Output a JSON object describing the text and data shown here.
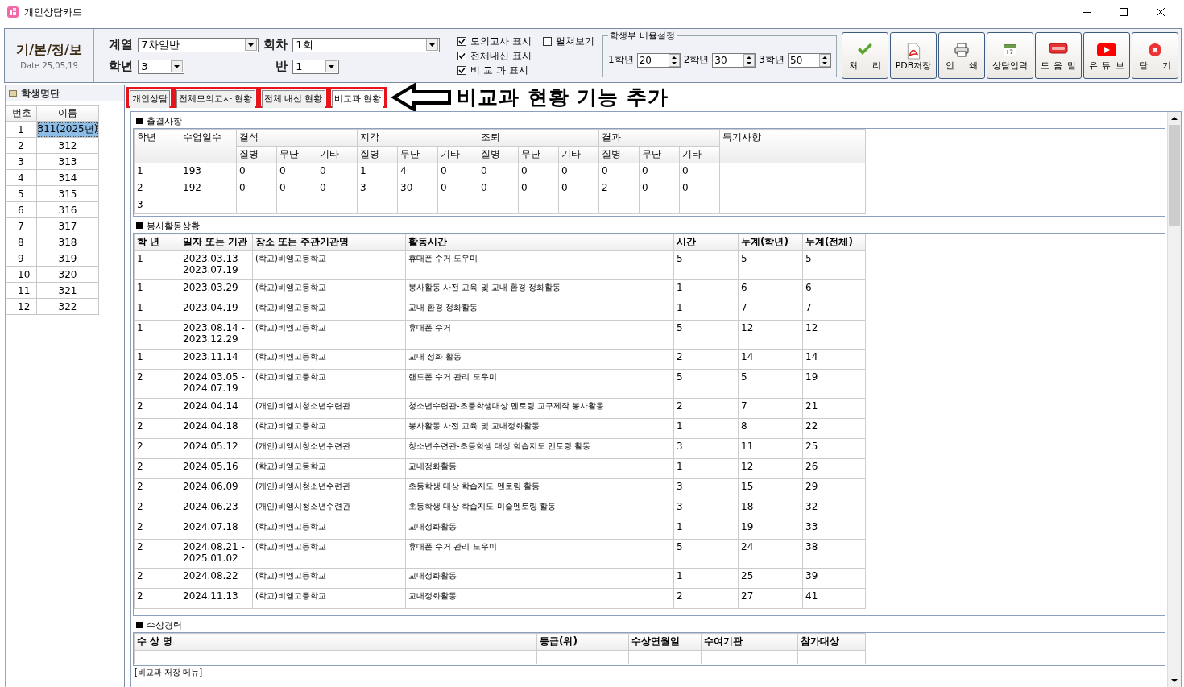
{
  "window": {
    "title": "개인상담카드"
  },
  "header": {
    "title": "기/본/정/보",
    "date": "Date 25,05,19"
  },
  "filters": [
    {
      "label": "계열",
      "value": "7차일반"
    },
    {
      "label": "회차",
      "value": "1회"
    },
    {
      "label": "학년",
      "value": "3"
    },
    {
      "label": "반",
      "value": "1"
    }
  ],
  "display_options": [
    {
      "label": "모의고사 표시",
      "checked": true
    },
    {
      "label": "전체내신 표시",
      "checked": true
    },
    {
      "label": "비 교 과 표시",
      "checked": true
    },
    {
      "label": "펼쳐보기",
      "checked": false
    }
  ],
  "ratio_settings": {
    "title": "학생부 비율설정",
    "fields": [
      {
        "label": "1학년",
        "value": "20"
      },
      {
        "label": "2학년",
        "value": "30"
      },
      {
        "label": "3학년",
        "value": "50"
      }
    ]
  },
  "toolbar": [
    {
      "kind": "check",
      "label": "처 리"
    },
    {
      "kind": "pdf",
      "label": "PDB저장"
    },
    {
      "kind": "print",
      "label": "인 쇄"
    },
    {
      "kind": "calendar",
      "label": "상담입력"
    },
    {
      "kind": "help",
      "label": "도 움 말"
    },
    {
      "kind": "video",
      "label": "유 튜 브"
    },
    {
      "kind": "close",
      "label": "닫 기"
    }
  ],
  "student_list": {
    "title": "학생명단",
    "columns": [
      "번호",
      "이름"
    ],
    "rows": [
      {
        "no": "1",
        "name": "311(2025년)",
        "selected": true
      },
      {
        "no": "2",
        "name": "312",
        "selected": false
      },
      {
        "no": "3",
        "name": "313",
        "selected": false
      },
      {
        "no": "4",
        "name": "314",
        "selected": false
      },
      {
        "no": "5",
        "name": "315",
        "selected": false
      },
      {
        "no": "6",
        "name": "316",
        "selected": false
      },
      {
        "no": "7",
        "name": "317",
        "selected": false
      },
      {
        "no": "8",
        "name": "318",
        "selected": false
      },
      {
        "no": "9",
        "name": "319",
        "selected": false
      },
      {
        "no": "10",
        "name": "320",
        "selected": false
      },
      {
        "no": "11",
        "name": "321",
        "selected": false
      },
      {
        "no": "12",
        "name": "322",
        "selected": false
      }
    ]
  },
  "tabs": [
    {
      "label": "개인상담",
      "selected": false
    },
    {
      "label": "전체모의고사 현황",
      "selected": false
    },
    {
      "label": "전체 내신 현황",
      "selected": false
    },
    {
      "label": "비교과 현황",
      "selected": true
    }
  ],
  "annotation": "비교과 현황 기능 추가",
  "attendance": {
    "title": "출결사항",
    "header_rows": [
      [
        {
          "text": "학년",
          "rowspan": 2
        },
        {
          "text": "수업일수",
          "rowspan": 2
        },
        {
          "text": "결석",
          "colspan": 3
        },
        {
          "text": "지각",
          "colspan": 3
        },
        {
          "text": "조퇴",
          "colspan": 3
        },
        {
          "text": "결과",
          "colspan": 3
        },
        {
          "text": "특기사항",
          "rowspan": 2
        }
      ],
      [
        {
          "text": "질병"
        },
        {
          "text": "무단"
        },
        {
          "text": "기타"
        },
        {
          "text": "질병"
        },
        {
          "text": "무단"
        },
        {
          "text": "기타"
        },
        {
          "text": "질병"
        },
        {
          "text": "무단"
        },
        {
          "text": "기타"
        },
        {
          "text": "질병"
        },
        {
          "text": "무단"
        },
        {
          "text": "기타"
        }
      ]
    ],
    "rows": [
      [
        "1",
        "193",
        "0",
        "0",
        "0",
        "1",
        "4",
        "0",
        "0",
        "0",
        "0",
        "0",
        "0",
        "0"
      ],
      [
        "2",
        "192",
        "0",
        "0",
        "0",
        "3",
        "30",
        "0",
        "0",
        "0",
        "0",
        "2",
        "0",
        "0"
      ],
      [
        "3"
      ]
    ]
  },
  "service": {
    "title": "봉사활동상황",
    "columns": [
      "학 년",
      "일자 또는 기관",
      "장소 또는 주관기관명",
      "활동시간",
      "시간",
      "누계(학년)",
      "누계(전체)"
    ],
    "rows": [
      [
        "1",
        "2023.03.13 -\n2023.07.19",
        "(학교)비엠고등학교",
        "휴대폰 수거 도우미",
        "5",
        "5",
        "5"
      ],
      [
        "1",
        "2023.03.29",
        "(학교)비엠고등학교",
        "봉사활동 사전 교육 및 교내 환경 정화활동",
        "1",
        "6",
        "6"
      ],
      [
        "1",
        "2023.04.19",
        "(학교)비엠고등학교",
        "교내 환경 정화활동",
        "1",
        "7",
        "7"
      ],
      [
        "1",
        "2023.08.14 -\n2023.12.29",
        "(학교)비엠고등학교",
        "휴대폰 수거",
        "5",
        "12",
        "12"
      ],
      [
        "1",
        "2023.11.14",
        "(학교)비엠고등학교",
        "교내 정화 활동",
        "2",
        "14",
        "14"
      ],
      [
        "2",
        "2024.03.05 -\n2024.07.19",
        "(학교)비엠고등학교",
        "핸드폰 수거 관리 도우미",
        "5",
        "5",
        "19"
      ],
      [
        "2",
        "2024.04.14",
        "(개인)비엠시청소년수련관",
        "청소년수련관-초등학생대상 멘토링 교구제작 봉사활동",
        "2",
        "7",
        "21"
      ],
      [
        "2",
        "2024.04.18",
        "(학교)비엠고등학교",
        "봉사활동 사전 교육 및 교내정화활동",
        "1",
        "8",
        "22"
      ],
      [
        "2",
        "2024.05.12",
        "(개인)비엠시청소년수련관",
        "청소년수련관-초등학생 대상 학습지도 멘토링 활동",
        "3",
        "11",
        "25"
      ],
      [
        "2",
        "2024.05.16",
        "(학교)비엠고등학교",
        "교내정화활동",
        "1",
        "12",
        "26"
      ],
      [
        "2",
        "2024.06.09",
        "(개인)비엠시청소년수련관",
        "초등학생 대상 학습지도 멘토링 활동",
        "3",
        "15",
        "29"
      ],
      [
        "2",
        "2024.06.23",
        "(개인)비엠시청소년수련관",
        "초등학생 대상 학습지도 미술멘토링 활동",
        "3",
        "18",
        "32"
      ],
      [
        "2",
        "2024.07.18",
        "(학교)비엠고등학교",
        "교내정화활동",
        "1",
        "19",
        "33"
      ],
      [
        "2",
        "2024.08.21 -\n2025.01.02",
        "(학교)비엠고등학교",
        "휴대폰 수거 관리 도우미",
        "5",
        "24",
        "38"
      ],
      [
        "2",
        "2024.08.22",
        "(학교)비엠고등학교",
        "교내정화활동",
        "1",
        "25",
        "39"
      ],
      [
        "2",
        "2024.11.13",
        "(학교)비엠고등학교",
        "교내정화활동",
        "2",
        "27",
        "41"
      ]
    ]
  },
  "awards": {
    "title": "수상경력",
    "columns": [
      "수 상 명",
      "등급(위)",
      "수상연월일",
      "수여기관",
      "참가대상"
    ]
  },
  "footer_label": "[비교과 저장 메뉴]"
}
